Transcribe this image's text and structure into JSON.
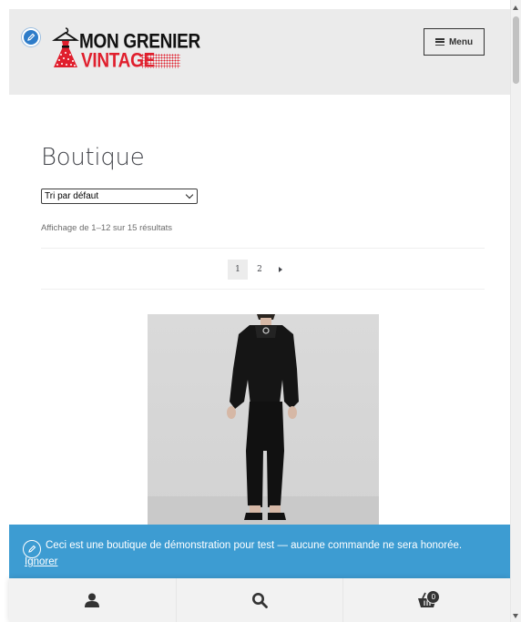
{
  "header": {
    "logo_line1": "MON GRENIER",
    "logo_line2": "VINTAGE",
    "menu_label": "Menu",
    "edit_icon": "pencil-icon"
  },
  "main": {
    "title": "Boutique",
    "sort": {
      "selected": "Tri par défaut"
    },
    "result_count": "Affichage de 1–12 sur 15 résultats",
    "pagination": {
      "pages": [
        "1",
        "2"
      ],
      "current": "1",
      "next_icon": "arrow-right-icon"
    }
  },
  "store_notice": {
    "text": "Ceci est une boutique de démonstration pour test — aucune commande ne sera honorée.",
    "dismiss": "Ignorer",
    "icon": "pencil-icon"
  },
  "handheld_footer": {
    "items": [
      {
        "icon": "user-icon"
      },
      {
        "icon": "search-icon"
      },
      {
        "icon": "basket-icon",
        "count": "0"
      }
    ]
  },
  "colors": {
    "header_bg": "#ebebeb",
    "notice_bg": "#3d9cd2",
    "brand_red": "#e01f2d",
    "edit_badge": "#2e7cc9"
  }
}
